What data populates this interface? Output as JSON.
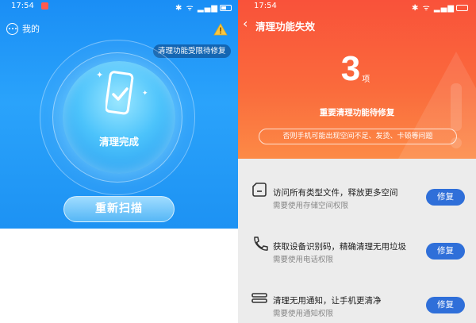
{
  "left": {
    "status": {
      "time": "17:54",
      "icons": "✱ ᯤ ▂▄▆"
    },
    "me_label": "我的",
    "tip": "清理功能受限待修复",
    "done_label": "清理完成",
    "rescan_label": "重新扫描"
  },
  "right": {
    "status": {
      "time": "17:54",
      "icons": "✱ ᯤ ▂▄▆"
    },
    "title": "清理功能失效",
    "count": "3",
    "count_unit": "项",
    "subtitle": "重要清理功能待修复",
    "hint": "否则手机可能出现空间不足、发烫、卡顿等问题",
    "items": [
      {
        "title": "访问所有类型文件，释放更多空间",
        "desc": "需要使用存储空间权限",
        "button": "修复",
        "icon": "sd-card-icon"
      },
      {
        "title": "获取设备识别码，精确清理无用垃圾",
        "desc": "需要使用电话权限",
        "button": "修复",
        "icon": "phone-handset-icon"
      },
      {
        "title": "清理无用通知，让手机更清净",
        "desc": "需要使用通知权限",
        "button": "修复",
        "icon": "notification-stack-icon"
      }
    ]
  },
  "colors": {
    "left_bg": "#1d92f3",
    "right_header": "#f9523a",
    "fix_button": "#2f6fd9"
  }
}
